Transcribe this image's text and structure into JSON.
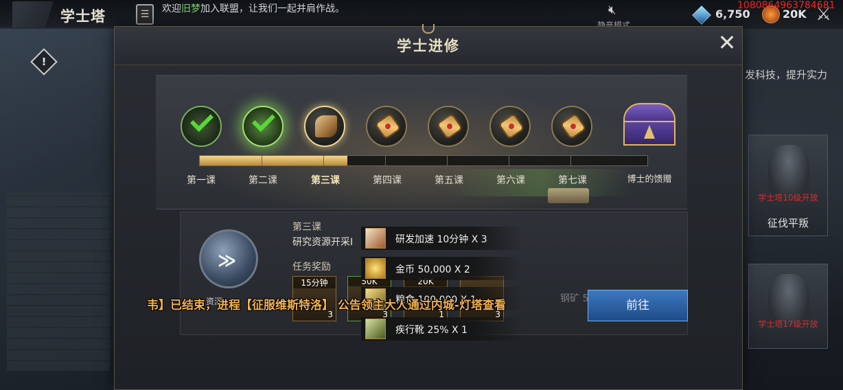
{
  "header": {
    "title": "学士塔",
    "chat_prefix": "欢迎",
    "chat_name": "旧梦",
    "chat_suffix": "加入联盟，让我们一起并肩作战。",
    "mute_label": "静音模式",
    "gems": "6,750",
    "power": "20K",
    "overlay_id": "1080864963784681"
  },
  "side": {
    "hint": "发科技，提升实力",
    "card1": {
      "lock_text": "学士塔10级开放",
      "label": "征伐平叛"
    },
    "card2": {
      "lock_text": "学士塔17级开放"
    }
  },
  "modal": {
    "title": "学士进修",
    "close": "✕",
    "progress_fraction": 0.33,
    "lessons": [
      {
        "label": "第一课",
        "state": "done"
      },
      {
        "label": "第二课",
        "state": "done"
      },
      {
        "label": "第三课",
        "state": "current"
      },
      {
        "label": "第四课",
        "state": "locked"
      },
      {
        "label": "第五课",
        "state": "locked"
      },
      {
        "label": "第六课",
        "state": "locked"
      },
      {
        "label": "第七课",
        "state": "locked"
      },
      {
        "label": "博士的馈赠",
        "state": "chest"
      }
    ],
    "task": {
      "lesson": "第三课",
      "desc": "研究资源开采I",
      "reward_title": "任务奖励",
      "caption": "资源",
      "rewards": [
        {
          "amount": "15分钟",
          "count": "3"
        },
        {
          "amount": "50K",
          "count": "3"
        },
        {
          "amount": "20K",
          "count": "1"
        },
        {
          "amount": "",
          "count": "3"
        }
      ],
      "ghost_text": "钢矿 50,000 X 2",
      "go_button": "前往"
    },
    "tooltip": [
      {
        "icon": "book",
        "label": "研发加速 10分钟 X 3"
      },
      {
        "icon": "coin",
        "label": "金币 50,000 X 2"
      },
      {
        "icon": "grain",
        "label": "粮食 100,000 X 1"
      },
      {
        "icon": "boot",
        "label": "疾行靴 25% X 1"
      }
    ]
  },
  "announcement": "韦】已结束，进程【征服维斯特洛】          公告领主大人通过内城-灯塔查看"
}
